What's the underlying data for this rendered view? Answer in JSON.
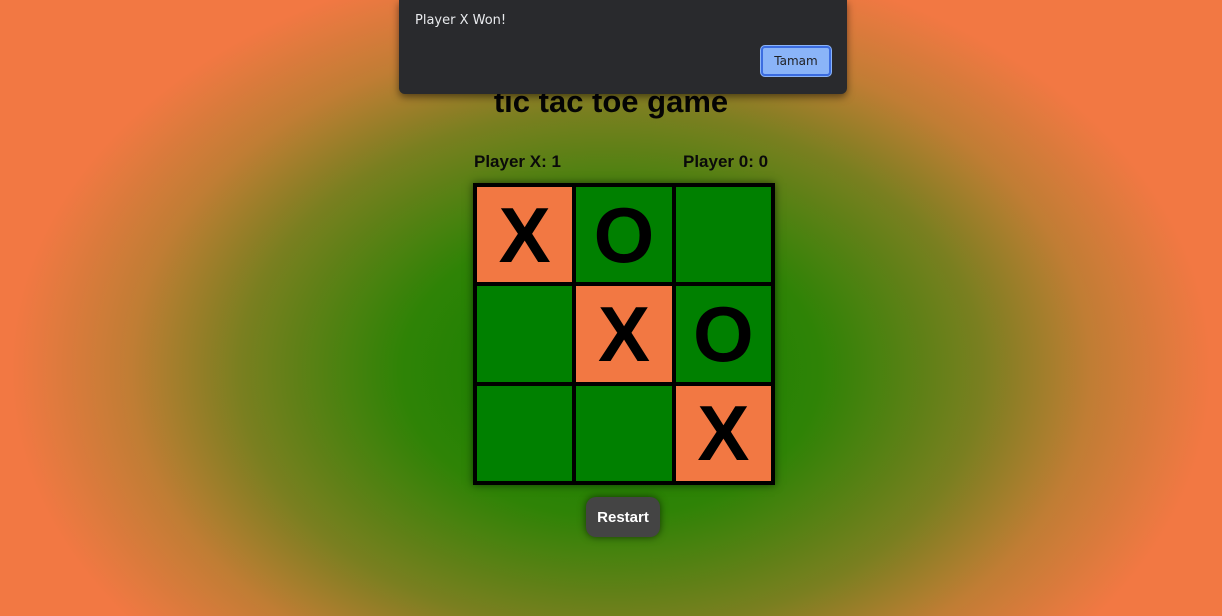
{
  "game": {
    "title": "tic tac toe game",
    "score_x_label": "Player X: 1",
    "score_o_label": "Player 0: 0",
    "restart_label": "Restart",
    "cells": [
      "X",
      "O",
      "",
      "",
      "X",
      "O",
      "",
      "",
      "X"
    ]
  },
  "dialog": {
    "message": "Player X Won!",
    "ok_label": "Tamam"
  },
  "colors": {
    "x_cell": "#f27843",
    "empty_cell": "#008000",
    "button": "#444444",
    "dialog_bg": "#292a2d",
    "dialog_ok": "#8ab4f8"
  }
}
